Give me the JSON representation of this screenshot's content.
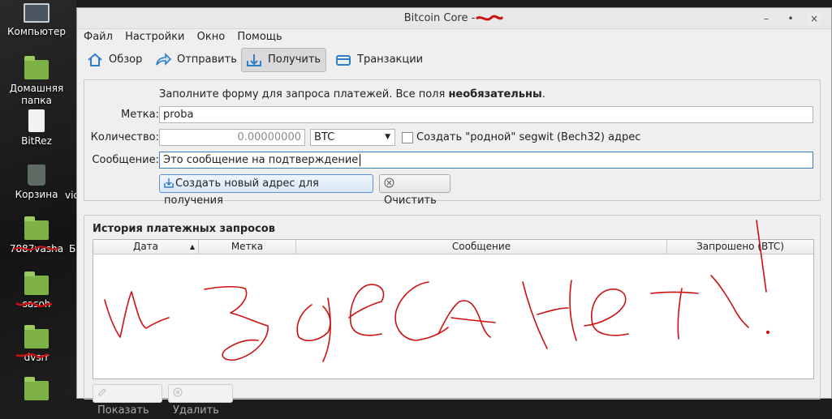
{
  "desktop": {
    "icons": [
      {
        "label": "Компьютер"
      },
      {
        "label": "Домашняя папка"
      },
      {
        "label": "BitRez"
      },
      {
        "label": "Корзина"
      },
      {
        "label": "7887vasha"
      },
      {
        "label": "sasoh"
      },
      {
        "label": "dvsrr"
      }
    ],
    "stray_labels": [
      "vic",
      "Бе"
    ]
  },
  "window": {
    "title": "Bitcoin Core -",
    "controls": {
      "minimize": "–",
      "maximize": "•",
      "close": "×"
    }
  },
  "menu": [
    "Файл",
    "Настройки",
    "Окно",
    "Помощь"
  ],
  "toolbar": {
    "items": [
      {
        "label": "Обзор",
        "icon": "home-icon"
      },
      {
        "label": "Отправить",
        "icon": "send-arrow-icon"
      },
      {
        "label": "Получить",
        "icon": "receive-inbox-icon",
        "active": true
      },
      {
        "label": "Транзакции",
        "icon": "transactions-card-icon"
      }
    ]
  },
  "form": {
    "hint_plain": "Заполните форму для запроса платежей. Все поля ",
    "hint_bold": "необязательны",
    "hint_end": ".",
    "label_label": "Метка:",
    "label_value": "proba",
    "amount_label": "Количество:",
    "amount_placeholder": "0.00000000",
    "unit": "BTC",
    "segwit_label": "Создать \"родной\" segwit (Bech32) адрес",
    "segwit_checked": false,
    "message_label": "Сообщение:",
    "message_value": "Это сообщение на подтверждение",
    "create_button": "Создать новый адрес для получения",
    "clear_button": "Очистить"
  },
  "history": {
    "title": "История платежных запросов",
    "columns": [
      "Дата",
      "Метка",
      "Сообщение",
      "Запрошено (BTC)"
    ],
    "rows": [],
    "show_button": "Показать",
    "remove_button": "Удалить"
  },
  "colors": {
    "scribble": "#cc1111",
    "accent": "#3d7dc8"
  }
}
